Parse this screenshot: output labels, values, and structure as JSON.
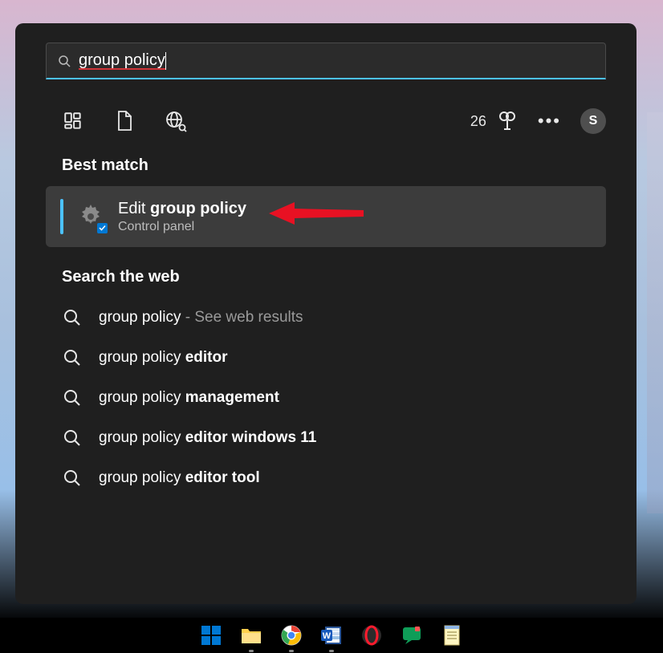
{
  "search": {
    "query": "group policy"
  },
  "scopes": {
    "count": "26",
    "avatar_letter": "S"
  },
  "sections": {
    "best_match": "Best match",
    "search_web": "Search the web"
  },
  "best_match": {
    "title_prefix": "Edit ",
    "title_bold": "group policy",
    "subtitle": "Control panel"
  },
  "web_results": [
    {
      "prefix": "group policy",
      "bold": "",
      "hint": " - See web results"
    },
    {
      "prefix": "group policy ",
      "bold": "editor",
      "hint": ""
    },
    {
      "prefix": "group policy ",
      "bold": "management",
      "hint": ""
    },
    {
      "prefix": "group policy ",
      "bold": "editor windows 11",
      "hint": ""
    },
    {
      "prefix": "group policy ",
      "bold": "editor tool",
      "hint": ""
    }
  ]
}
